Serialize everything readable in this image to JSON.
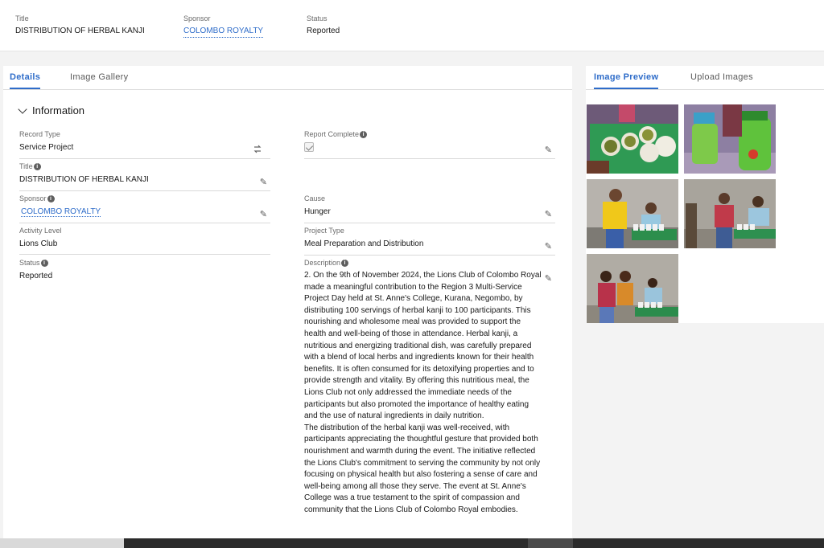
{
  "header": {
    "title_label": "Title",
    "title_value": "DISTRIBUTION OF HERBAL KANJI",
    "sponsor_label": "Sponsor",
    "sponsor_value": "COLOMBO ROYALTY",
    "status_label": "Status",
    "status_value": "Reported"
  },
  "left_tabs": [
    "Details",
    "Image Gallery"
  ],
  "section_title": "Information",
  "fields": {
    "record_type": {
      "label": "Record Type",
      "value": "Service Project"
    },
    "report_complete": {
      "label": "Report Complete",
      "checked": true
    },
    "title": {
      "label": "Title",
      "value": "DISTRIBUTION OF HERBAL KANJI"
    },
    "sponsor": {
      "label": "Sponsor",
      "value": "COLOMBO ROYALTY"
    },
    "cause": {
      "label": "Cause",
      "value": "Hunger"
    },
    "activity_level": {
      "label": "Activity Level",
      "value": "Lions Club"
    },
    "project_type": {
      "label": "Project Type",
      "value": "Meal Preparation and Distribution"
    },
    "status": {
      "label": "Status",
      "value": "Reported"
    },
    "description": {
      "label": "Description",
      "value": "2. On the 9th of November 2024, the Lions Club of Colombo Royal made a meaningful contribution to the Region 3 Multi-Service Project Day held at St. Anne's College, Kurana, Negombo, by distributing 100 servings of herbal kanji to 100 participants. This nourishing and wholesome meal was provided to support the health and well-being of those in attendance. Herbal kanji, a nutritious and energizing traditional dish, was carefully prepared with a blend of local herbs and ingredients known for their health benefits. It is often consumed for its detoxifying properties and to provide strength and vitality. By offering this nutritious meal, the Lions Club not only addressed the immediate needs of the participants but also promoted the importance of healthy eating and the use of natural ingredients in daily nutrition.\nThe distribution of the herbal kanji was well-received, with participants appreciating the thoughtful gesture that provided both nourishment and warmth during the event. The initiative reflected the Lions Club's commitment to serving the community by not only focusing on physical health but also fostering a sense of care and well-being among all those they serve. The event at St. Anne's College was a true testament to the spirit of compassion and community that the Lions Club of Colombo Royal embodies."
    }
  },
  "right_tabs": [
    "Image Preview",
    "Upload Images"
  ],
  "icons": {
    "info": "info-icon",
    "edit": "pencil-icon",
    "change_record_type": "swap-icon",
    "chevron": "chevron-down-icon"
  },
  "colors": {
    "accent": "#2e6cc9",
    "background": "#f3f3f3",
    "card": "#ffffff"
  }
}
